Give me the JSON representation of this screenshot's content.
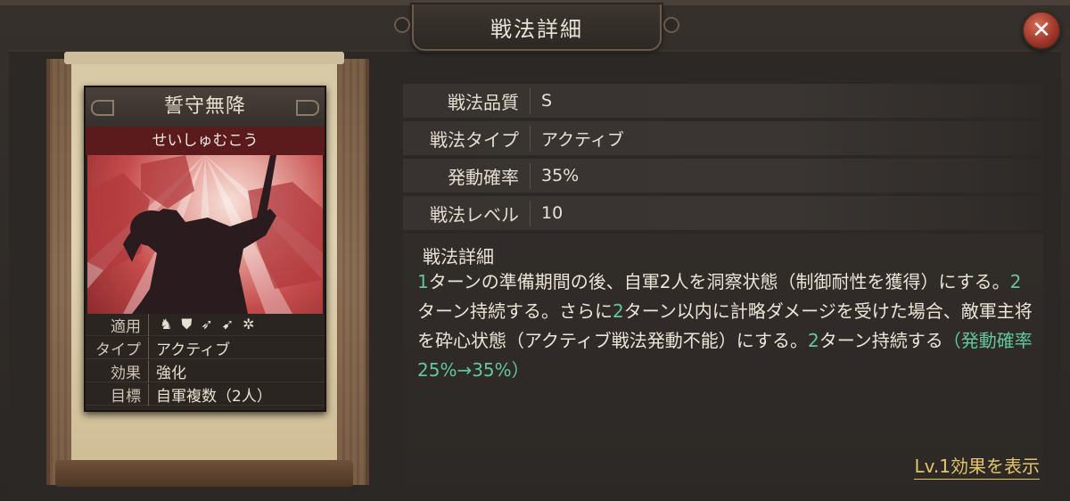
{
  "window": {
    "title": "戦法詳細",
    "close_label": "✕"
  },
  "card": {
    "name": "誓守無降",
    "reading": "せいしゅむこう",
    "stats": {
      "apply_label": "適用",
      "type_label": "タイプ",
      "type_value": "アクティブ",
      "effect_label": "効果",
      "effect_value": "強化",
      "target_label": "目標",
      "target_value": "自軍複数（2人）"
    },
    "apply_icons": [
      "cavalry-icon",
      "shield-icon",
      "bow-icon",
      "spear-icon",
      "wheel-icon"
    ],
    "art_colors": {
      "primary": "#c54b4b",
      "dark": "#2a1c1e",
      "light": "#f7e0d8"
    }
  },
  "info": [
    {
      "label": "戦法品質",
      "value": "S"
    },
    {
      "label": "戦法タイプ",
      "value": "アクティブ"
    },
    {
      "label": "発動確率",
      "value": "35%"
    },
    {
      "label": "戦法レベル",
      "value": "10"
    }
  ],
  "detail": {
    "title": "戦法詳細",
    "segments": [
      {
        "t": "1",
        "hl": true
      },
      {
        "t": "ターンの準備期間の後、自軍2人を洞察状態（制御耐性を獲得）にする。",
        "hl": false
      },
      {
        "t": "2",
        "hl": true
      },
      {
        "t": "ターン持続する。さらに",
        "hl": false
      },
      {
        "t": "2",
        "hl": true
      },
      {
        "t": "ターン以内に計略ダメージを受けた場合、敵軍主将を砕心状態（アクティブ戦法発動不能）にする。",
        "hl": false
      },
      {
        "t": "2",
        "hl": true
      },
      {
        "t": "ターン持続する",
        "hl": false
      },
      {
        "t": "（発動確率25%→35%）",
        "hl": true
      }
    ],
    "highlight_color": "#62c79a"
  },
  "lv_link": "Lv.1効果を表示"
}
